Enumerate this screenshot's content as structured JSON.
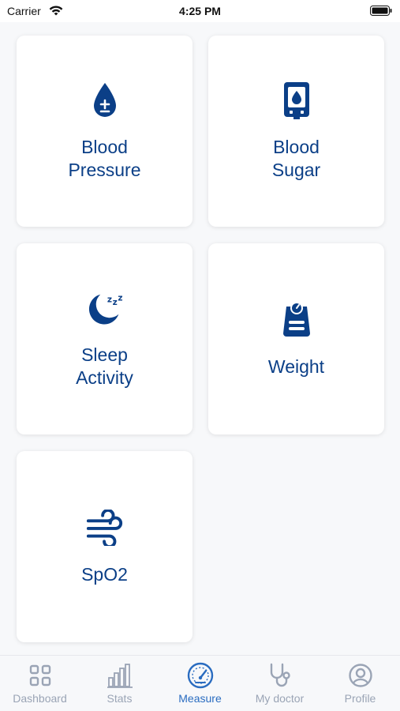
{
  "status_bar": {
    "carrier": "Carrier",
    "time": "4:25 PM"
  },
  "accent_color": "#0b3f87",
  "cards": [
    {
      "label": "Blood\nPressure",
      "icon": "blood-drop-icon"
    },
    {
      "label": "Blood\nSugar",
      "icon": "glucose-meter-icon"
    },
    {
      "label": "Sleep\nActivity",
      "icon": "sleep-moon-icon"
    },
    {
      "label": "Weight",
      "icon": "weight-scale-icon"
    },
    {
      "label": "SpO2",
      "icon": "wind-icon"
    }
  ],
  "tabs": [
    {
      "label": "Dashboard",
      "icon": "grid-icon",
      "active": false
    },
    {
      "label": "Stats",
      "icon": "bar-chart-icon",
      "active": false
    },
    {
      "label": "Measure",
      "icon": "gauge-icon",
      "active": true
    },
    {
      "label": "My doctor",
      "icon": "stethoscope-icon",
      "active": false
    },
    {
      "label": "Profile",
      "icon": "profile-icon",
      "active": false
    }
  ]
}
